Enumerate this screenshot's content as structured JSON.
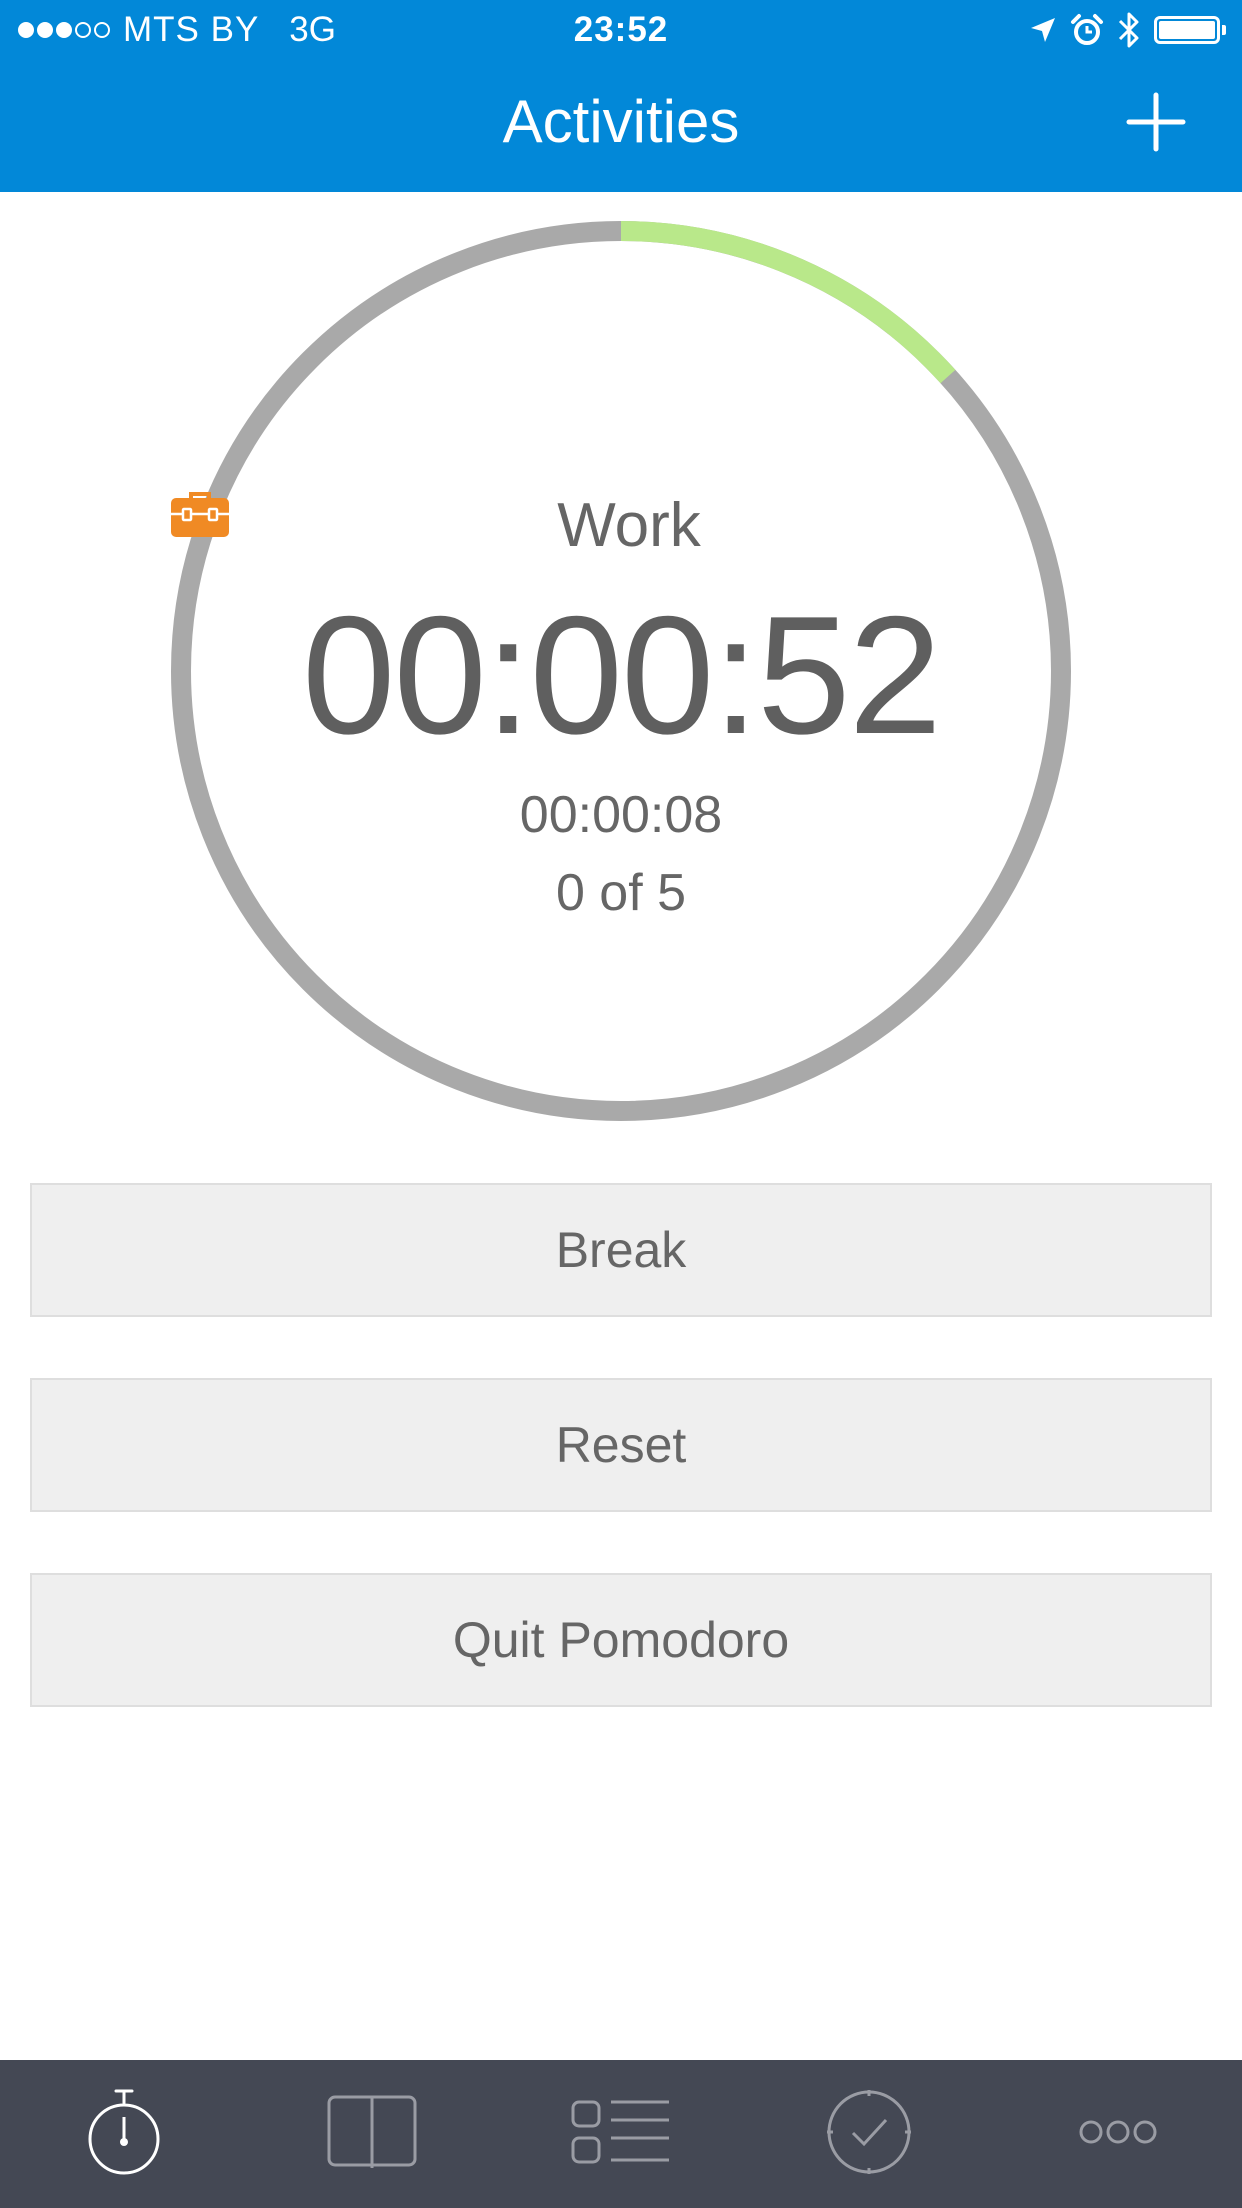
{
  "status_bar": {
    "signal_dots": [
      true,
      true,
      true,
      false,
      false
    ],
    "carrier": "MTS BY",
    "network": "3G",
    "time": "23:52"
  },
  "header": {
    "title": "Activities",
    "add_icon": "plus-icon"
  },
  "timer": {
    "activity_icon": "toolbox-icon",
    "activity_label": "Work",
    "elapsed": "00:00:52",
    "remaining": "00:00:08",
    "counter": "0 of 5",
    "progress": 0.1333,
    "progress_color": "#b9e88a",
    "track_color": "#a9a9a9"
  },
  "buttons": {
    "break_label": "Break",
    "reset_label": "Reset",
    "quit_label": "Quit Pomodoro"
  },
  "tabbar": {
    "tabs": [
      {
        "icon": "stopwatch-icon",
        "active": true
      },
      {
        "icon": "book-icon",
        "active": false
      },
      {
        "icon": "list-icon",
        "active": false
      },
      {
        "icon": "checkmark-clock-icon",
        "active": false
      },
      {
        "icon": "more-icon",
        "active": false
      }
    ]
  },
  "colors": {
    "header": "#0288d8",
    "tabbar": "#444854",
    "accent_orange": "#f08a24"
  }
}
